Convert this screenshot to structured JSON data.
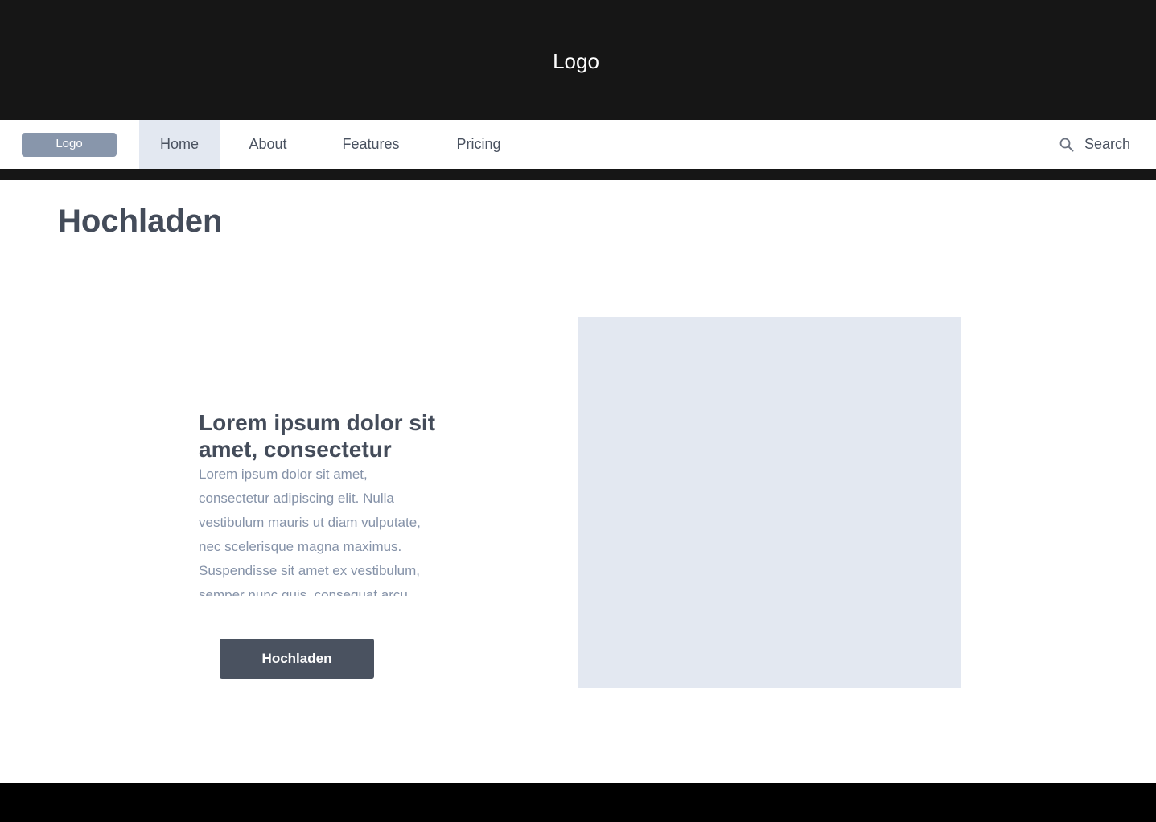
{
  "header": {
    "logo_text": "Logo"
  },
  "nav": {
    "logo_text": "Logo",
    "items": [
      {
        "label": "Home",
        "active": true
      },
      {
        "label": "About",
        "active": false
      },
      {
        "label": "Features",
        "active": false
      },
      {
        "label": "Pricing",
        "active": false
      }
    ],
    "search_label": "Search",
    "search_icon": "magnifier"
  },
  "page": {
    "title": "Hochladen"
  },
  "hero": {
    "heading": "Lorem ipsum dolor sit amet, consectetur",
    "body": "Lorem ipsum dolor sit amet, consectetur adipiscing elit. Nulla vestibulum mauris ut diam vulputate, nec scelerisque magna maximus. Suspendisse sit amet ex vestibulum, semper nunc quis, consequat arcu.",
    "button_label": "Hochladen"
  },
  "colors": {
    "header_bg": "#161616",
    "nav_active_bg": "#e3e8f1",
    "nav_logo_bg": "#8896ab",
    "text_dark": "#444c5a",
    "text_muted": "#8592a8",
    "button_bg": "#4a5260",
    "placeholder_bg": "#e3e8f1",
    "footer_bg": "#000000"
  }
}
